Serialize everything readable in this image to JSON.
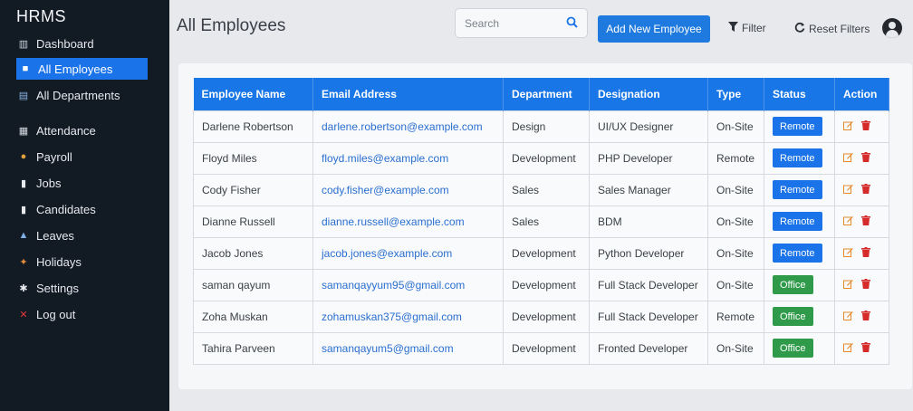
{
  "app": {
    "brand": "HRMS"
  },
  "sidebar": {
    "items": [
      {
        "label": "Dashboard",
        "icon": "chart-icon",
        "glyph": "▥",
        "color": "#c9d3df"
      },
      {
        "label": "All Employees",
        "icon": "user-icon",
        "glyph": "■",
        "color": "#ffffff",
        "active": true
      },
      {
        "label": "All Departments",
        "icon": "department-icon",
        "glyph": "▤",
        "color": "#8bb4e0"
      },
      {
        "label": "Attendance",
        "icon": "calendar-icon",
        "glyph": "▦",
        "color": "#d9dde3"
      },
      {
        "label": "Payroll",
        "icon": "money-bag-icon",
        "glyph": "●",
        "color": "#e0a23a"
      },
      {
        "label": "Jobs",
        "icon": "document-icon",
        "glyph": "▮",
        "color": "#e6e9ee"
      },
      {
        "label": "Candidates",
        "icon": "clipboard-icon",
        "glyph": "▮",
        "color": "#e6e9ee"
      },
      {
        "label": "Leaves",
        "icon": "leaves-icon",
        "glyph": "▲",
        "color": "#7fb0e8"
      },
      {
        "label": "Holidays",
        "icon": "holiday-icon",
        "glyph": "✦",
        "color": "#e58a3a"
      },
      {
        "label": "Settings",
        "icon": "gear-icon",
        "glyph": "✱",
        "color": "#e6e9ee"
      },
      {
        "label": "Log out",
        "icon": "close-icon",
        "glyph": "✕",
        "color": "#e0383b"
      }
    ]
  },
  "header": {
    "title": "All Employees",
    "search_placeholder": "Search",
    "add_label": "Add New Employee",
    "filter_label": "Filter",
    "reset_label": "Reset Filters"
  },
  "table": {
    "columns": [
      "Employee Name",
      "Email Address",
      "Department",
      "Designation",
      "Type",
      "Status",
      "Action"
    ],
    "rows": [
      {
        "name": "Darlene Robertson",
        "email": "darlene.robertson@example.com",
        "department": "Design",
        "designation": "UI/UX Designer",
        "type": "On-Site",
        "status": "Remote"
      },
      {
        "name": "Floyd Miles",
        "email": "floyd.miles@example.com",
        "department": "Development",
        "designation": "PHP Developer",
        "type": "Remote",
        "status": "Remote"
      },
      {
        "name": "Cody Fisher",
        "email": "cody.fisher@example.com",
        "department": "Sales",
        "designation": "Sales Manager",
        "type": "On-Site",
        "status": "Remote"
      },
      {
        "name": "Dianne Russell",
        "email": "dianne.russell@example.com",
        "department": "Sales",
        "designation": "BDM",
        "type": "On-Site",
        "status": "Remote"
      },
      {
        "name": "Jacob Jones",
        "email": "jacob.jones@example.com",
        "department": "Development",
        "designation": "Python Developer",
        "type": "On-Site",
        "status": "Remote"
      },
      {
        "name": "saman qayum",
        "email": "samanqayyum95@gmail.com",
        "department": "Development",
        "designation": "Full Stack Developer",
        "type": "On-Site",
        "status": "Office"
      },
      {
        "name": "Zoha Muskan",
        "email": "zohamuskan375@gmail.com",
        "department": "Development",
        "designation": "Full Stack Developer",
        "type": "Remote",
        "status": "Office"
      },
      {
        "name": "Tahira Parveen",
        "email": "samanqayum5@gmail.com",
        "department": "Development",
        "designation": "Fronted Developer",
        "type": "On-Site",
        "status": "Office"
      }
    ]
  },
  "colors": {
    "accent": "#1a73e8",
    "sidebar": "#121a24",
    "office": "#2f9a4a",
    "danger": "#d62b2b"
  }
}
